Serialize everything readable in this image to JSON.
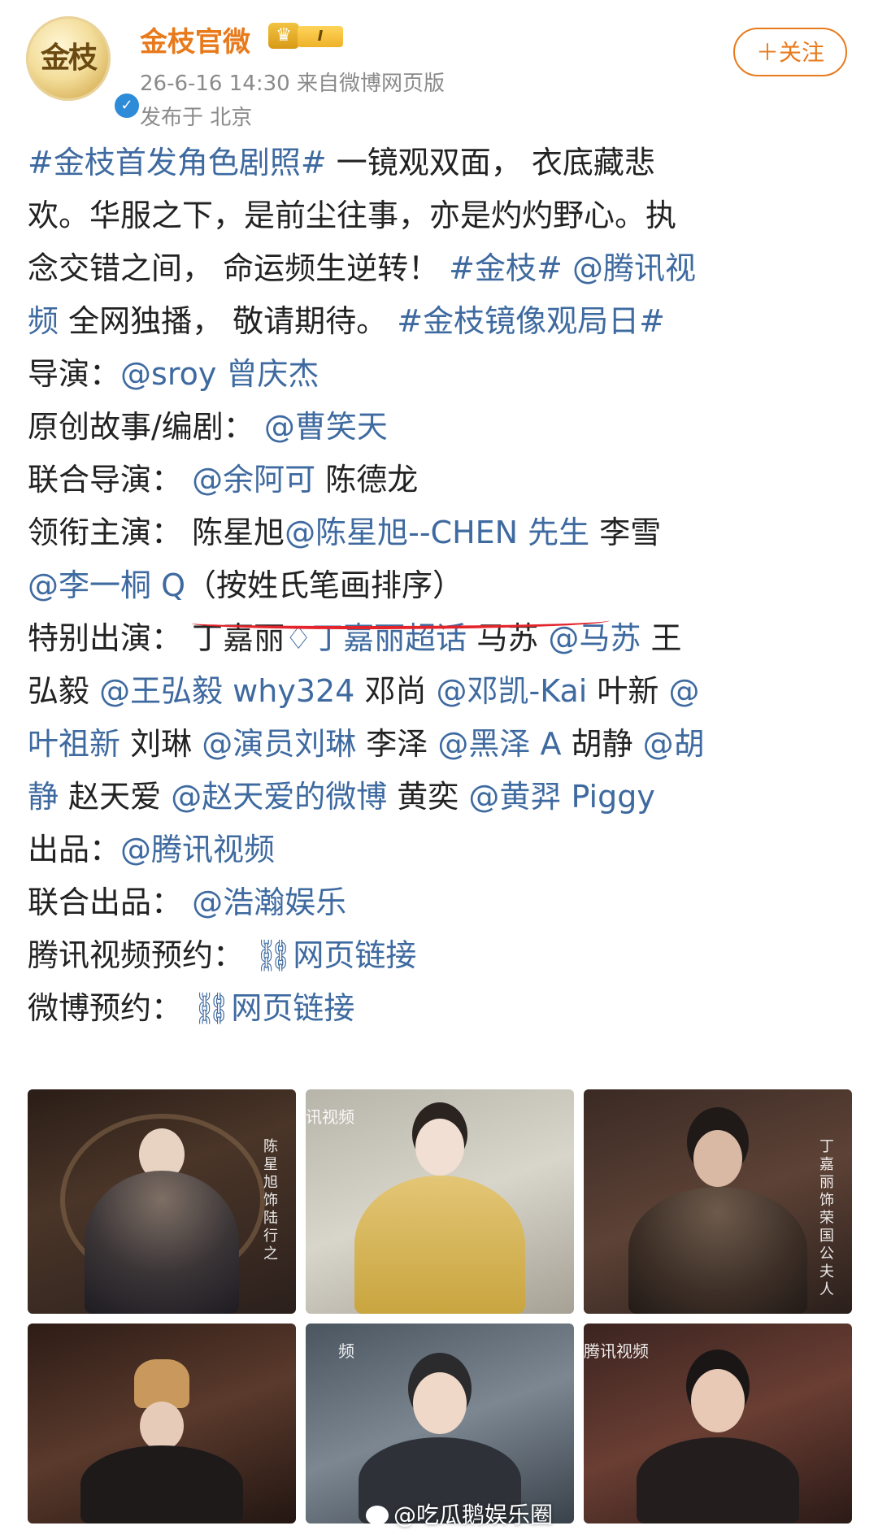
{
  "header": {
    "username": "金枝官微",
    "badge": "I",
    "time": "26-6-16 14:30",
    "source": "来自微博网页版",
    "location": "发布于 北京",
    "follow_label": "＋关注",
    "avatar_text": "金枝"
  },
  "post": {
    "line1": [
      {
        "t": "tag",
        "v": "#金枝首发角色剧照#"
      },
      {
        "t": "text",
        "v": " 一镜观双面， 衣底藏悲"
      }
    ],
    "line2": "欢。华服之下，是前尘往事，亦是灼灼野心。执",
    "line3": [
      {
        "t": "text",
        "v": "念交错之间， 命运频生逆转！ "
      },
      {
        "t": "tag",
        "v": "#金枝#"
      },
      {
        "t": "text",
        "v": " "
      },
      {
        "t": "mention",
        "v": "@腾讯视"
      }
    ],
    "line4": [
      {
        "t": "mention",
        "v": "频"
      },
      {
        "t": "text",
        "v": " 全网独播， 敬请期待。 "
      },
      {
        "t": "tag",
        "v": "#金枝镜像观局日#"
      }
    ],
    "director_label": "导演：",
    "director_value": "@sroy 曾庆杰",
    "writer_label": "原创故事/编剧：",
    "writer_value": "@曹笑天",
    "co_director_label": "联合导演：",
    "co_director_mention": "@余阿可",
    "co_director_name": "陈德龙",
    "lead_label": "领衔主演：",
    "lead_name1": "陈星旭",
    "lead_mention1": "@陈星旭--CHEN 先生",
    "lead_name2": "李雪",
    "lead_mention2": "@李一桐 Q",
    "lead_note": "（按姓氏笔画排序）",
    "special_label": "特别出演：",
    "special_line1": [
      {
        "t": "text",
        "v": "丁嘉丽"
      },
      {
        "t": "mention",
        "v": "♢丁嘉丽超话"
      },
      {
        "t": "text",
        "v": " 马苏 "
      },
      {
        "t": "mention",
        "v": "@马苏"
      },
      {
        "t": "text",
        "v": " 王"
      }
    ],
    "special_line2": [
      {
        "t": "text",
        "v": "弘毅 "
      },
      {
        "t": "mention",
        "v": "@王弘毅 why324"
      },
      {
        "t": "text",
        "v": " 邓尚 "
      },
      {
        "t": "mention",
        "v": "@邓凯-Kai"
      },
      {
        "t": "text",
        "v": " 叶新 "
      },
      {
        "t": "mention",
        "v": "@"
      }
    ],
    "special_line3": [
      {
        "t": "mention",
        "v": "叶祖新"
      },
      {
        "t": "text",
        "v": " 刘琳 "
      },
      {
        "t": "mention",
        "v": "@演员刘琳"
      },
      {
        "t": "text",
        "v": " 李泽 "
      },
      {
        "t": "mention",
        "v": "@黑泽 A"
      },
      {
        "t": "text",
        "v": " 胡静 "
      },
      {
        "t": "mention",
        "v": "@胡"
      }
    ],
    "special_line4": [
      {
        "t": "mention",
        "v": "静"
      },
      {
        "t": "text",
        "v": " 赵天爱 "
      },
      {
        "t": "mention",
        "v": "@赵天爱的微博"
      },
      {
        "t": "text",
        "v": " 黄奕 "
      },
      {
        "t": "mention",
        "v": "@黄羿 Piggy"
      }
    ],
    "producer_label": "出品：",
    "producer_value": "@腾讯视频",
    "co_producer_label": "联合出品：",
    "co_producer_value": "@浩瀚娱乐",
    "tencent_reserve_label": "腾讯视频预约：",
    "tencent_reserve_link": "⛓网页链接",
    "weibo_reserve_label": "微博预约：",
    "weibo_reserve_link": "⛓网页链接"
  },
  "gallery": {
    "thumb1_caption": "陈星旭 饰 陆行之",
    "thumb2_watermark": "讯视频",
    "thumb3_caption": "丁嘉丽 饰 荣国公夫人",
    "thumb5_watermark": "频",
    "thumb6_watermark": "腾讯视频",
    "bottom_watermark": "@吃瓜鹅娱乐圈"
  },
  "colors": {
    "username": "#e87a1c",
    "link": "#3e6aa0",
    "underline": "#e3242b",
    "meta": "#8a8a8a"
  }
}
